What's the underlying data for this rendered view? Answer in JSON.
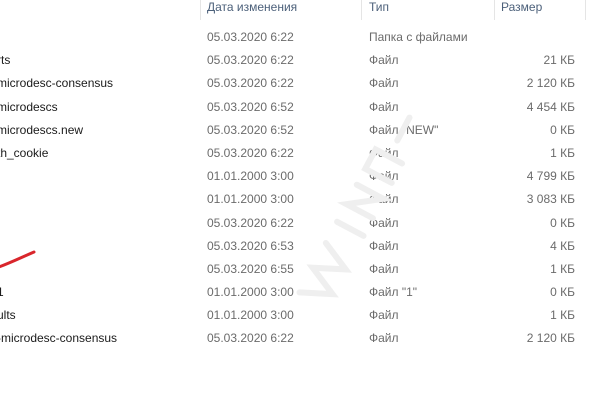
{
  "columns": {
    "date_modified": "Дата изменения",
    "type": "Тип",
    "size": "Размер"
  },
  "rows": [
    {
      "name": "",
      "date": "05.03.2020 6:22",
      "type": "Папка с файлами",
      "size": ""
    },
    {
      "name": "rts",
      "date": "05.03.2020 6:22",
      "type": "Файл",
      "size": "21 КБ"
    },
    {
      "name": "microdesc-consensus",
      "date": "05.03.2020 6:22",
      "type": "Файл",
      "size": "2 120 КБ"
    },
    {
      "name": "microdescs",
      "date": "05.03.2020 6:52",
      "type": "Файл",
      "size": "4 454 КБ"
    },
    {
      "name": "microdescs.new",
      "date": "05.03.2020 6:52",
      "type": "Файл \"NEW\"",
      "size": "0 КБ"
    },
    {
      "name": "th_cookie",
      "date": "05.03.2020 6:22",
      "type": "Файл",
      "size": "1 КБ"
    },
    {
      "name": "",
      "date": "01.01.2000 3:00",
      "type": "Файл",
      "size": "4 799 КБ"
    },
    {
      "name": "",
      "date": "01.01.2000 3:00",
      "type": "Файл",
      "size": "3 083 КБ"
    },
    {
      "name": "",
      "date": "05.03.2020 6:22",
      "type": "Файл",
      "size": "0 КБ"
    },
    {
      "name": "",
      "date": "05.03.2020 6:53",
      "type": "Файл",
      "size": "4 КБ"
    },
    {
      "name": "",
      "date": "05.03.2020 6:55",
      "type": "Файл",
      "size": "1 КБ"
    },
    {
      "name": "1",
      "date": "01.01.2000 3:00",
      "type": "Файл \"1\"",
      "size": "0 КБ"
    },
    {
      "name": "ults",
      "date": "01.01.2000 3:00",
      "type": "Файл",
      "size": "1 КБ"
    },
    {
      "name": "-microdesc-consensus",
      "date": "05.03.2020 6:22",
      "type": "Файл",
      "size": "2 120 КБ"
    }
  ],
  "colors": {
    "header_text": "#4c607a",
    "secondary_text": "#6b6b6b",
    "name_text": "#1a1a1a",
    "annotation_red": "#d9262c"
  }
}
